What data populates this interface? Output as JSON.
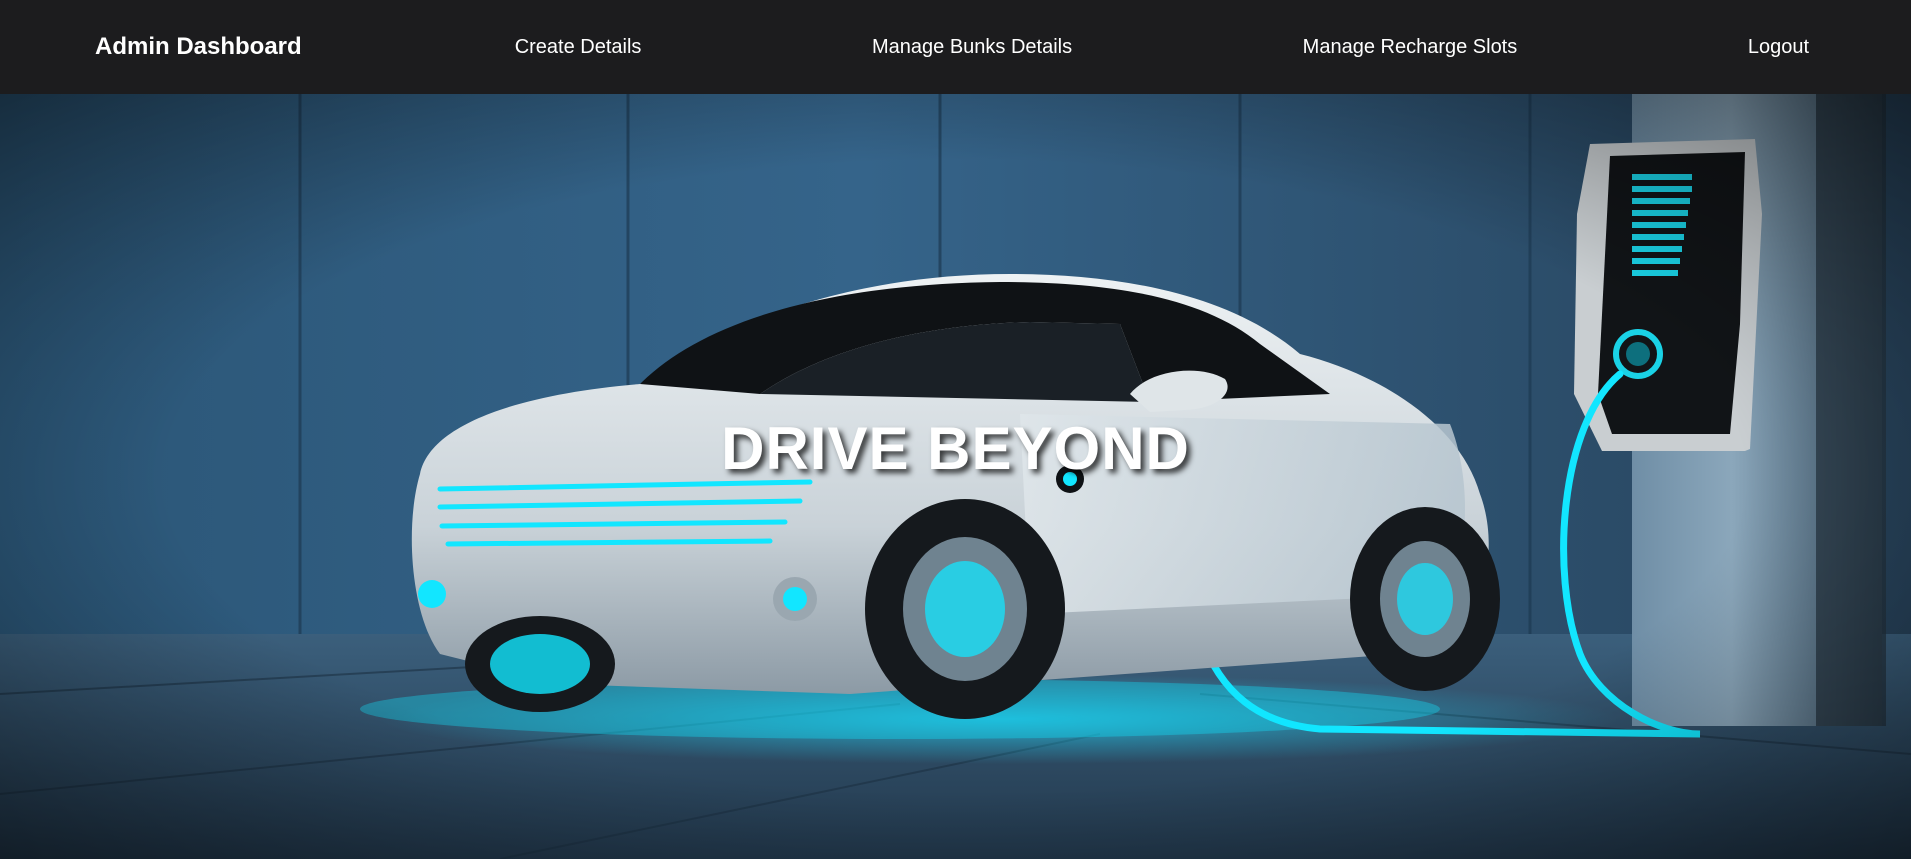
{
  "nav": {
    "brand": "Admin Dashboard",
    "links": [
      {
        "label": "Create Details"
      },
      {
        "label": "Manage Bunks Details"
      },
      {
        "label": "Manage Recharge Slots"
      },
      {
        "label": "Logout"
      }
    ]
  },
  "hero": {
    "title": "DRIVE BEYOND"
  },
  "colors": {
    "navbar_bg": "#1c1c1e",
    "accent_glow": "#12e6ff",
    "wall": "#2f5b7d"
  }
}
